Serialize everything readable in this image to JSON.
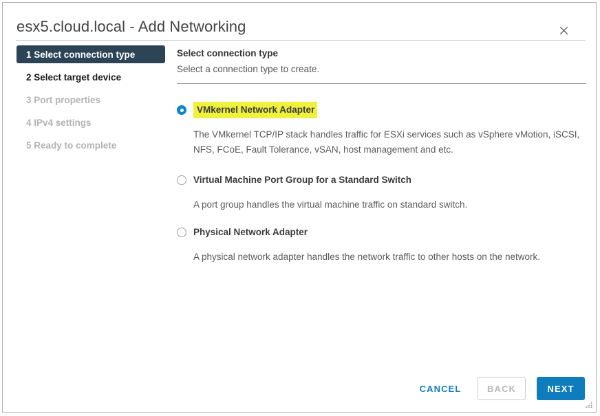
{
  "window": {
    "title": "esx5.cloud.local - Add Networking",
    "close_icon": "close-icon",
    "resize_grip_icon": "resize-grip-icon"
  },
  "steps": [
    {
      "label": "1 Select connection type",
      "state": "active"
    },
    {
      "label": "2 Select target device",
      "state": "visited"
    },
    {
      "label": "3 Port properties",
      "state": "pending"
    },
    {
      "label": "4 IPv4 settings",
      "state": "pending"
    },
    {
      "label": "5 Ready to complete",
      "state": "pending"
    }
  ],
  "content": {
    "heading": "Select connection type",
    "subheading": "Select a connection type to create."
  },
  "options": [
    {
      "label": "VMkernel Network Adapter",
      "selected": true,
      "highlighted": true,
      "description": "The VMkernel TCP/IP stack handles traffic for ESXi services such as vSphere vMotion, iSCSI, NFS, FCoE, Fault Tolerance, vSAN, host management and etc."
    },
    {
      "label": "Virtual Machine Port Group for a Standard Switch",
      "selected": false,
      "highlighted": false,
      "description": "A port group handles the virtual machine traffic on standard switch."
    },
    {
      "label": "Physical Network Adapter",
      "selected": false,
      "highlighted": false,
      "description": "A physical network adapter handles the network traffic to other hosts on the network."
    }
  ],
  "footer": {
    "cancel_label": "CANCEL",
    "back_label": "BACK",
    "next_label": "NEXT"
  },
  "colors": {
    "accent_blue": "#0f7dbd",
    "active_step_bg": "#2d4456",
    "highlight_yellow": "#eff13d",
    "radio_selected": "#0f86c8"
  }
}
